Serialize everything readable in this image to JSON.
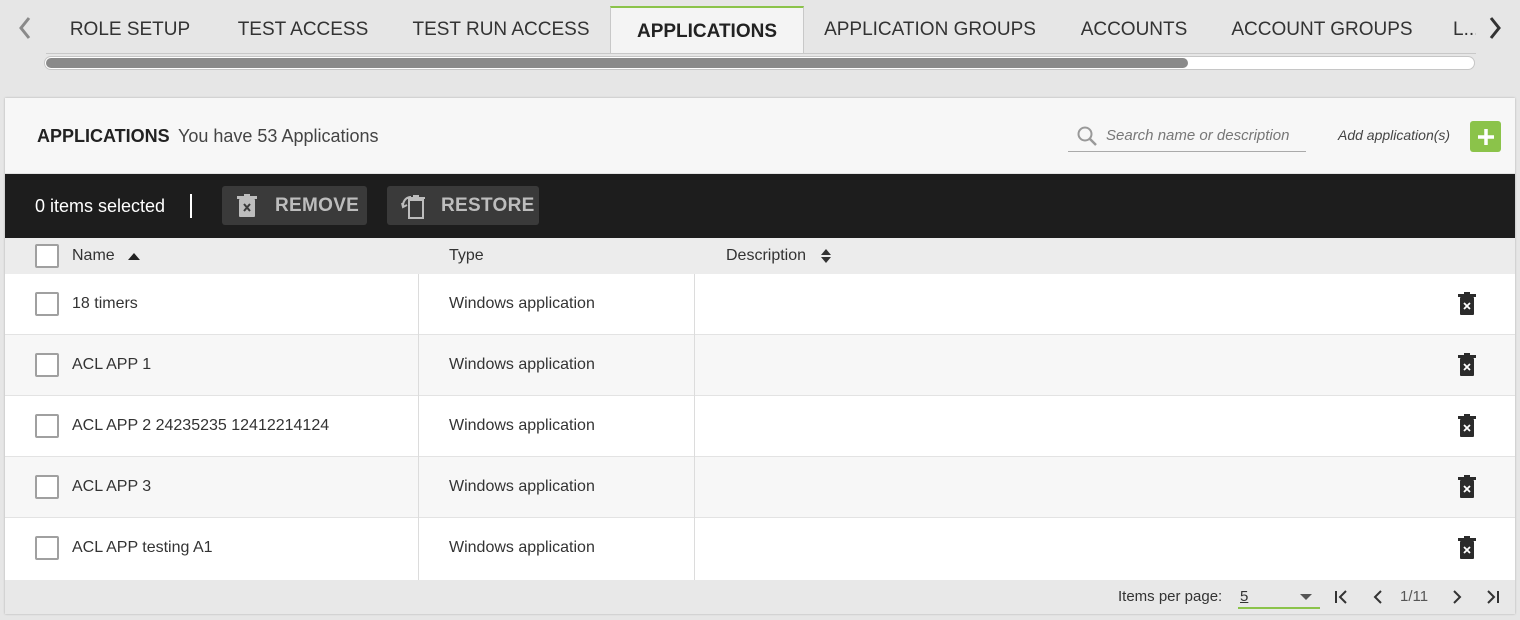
{
  "tabs": [
    {
      "label": "ROLE SETUP"
    },
    {
      "label": "TEST ACCESS"
    },
    {
      "label": "TEST RUN ACCESS"
    },
    {
      "label": "APPLICATIONS",
      "active": true
    },
    {
      "label": "APPLICATION GROUPS"
    },
    {
      "label": "ACCOUNTS"
    },
    {
      "label": "ACCOUNT GROUPS"
    },
    {
      "label": "L..."
    }
  ],
  "tab_scroll": {
    "visible_fraction": 0.8
  },
  "header": {
    "title": "APPLICATIONS",
    "count_text": "You have 53 Applications",
    "search_placeholder": "Search name or description",
    "add_label": "Add application(s)"
  },
  "action_bar": {
    "selected_text": "0 items selected",
    "remove_label": "REMOVE",
    "restore_label": "RESTORE"
  },
  "columns": {
    "name": "Name",
    "type": "Type",
    "description": "Description"
  },
  "rows": [
    {
      "name": "18 timers",
      "type": "Windows application",
      "description": ""
    },
    {
      "name": "ACL APP 1",
      "type": "Windows application",
      "description": ""
    },
    {
      "name": "ACL APP 2 24235235 12412214124",
      "type": "Windows application",
      "description": ""
    },
    {
      "name": "ACL APP 3",
      "type": "Windows application",
      "description": ""
    },
    {
      "name": "ACL APP testing A1",
      "type": "Windows application",
      "description": ""
    }
  ],
  "pagination": {
    "items_per_page_label": "Items per page:",
    "items_per_page": "5",
    "page_info": "1/11"
  },
  "colors": {
    "accent": "#8bc34a",
    "action_bar": "#1d1d1d"
  }
}
